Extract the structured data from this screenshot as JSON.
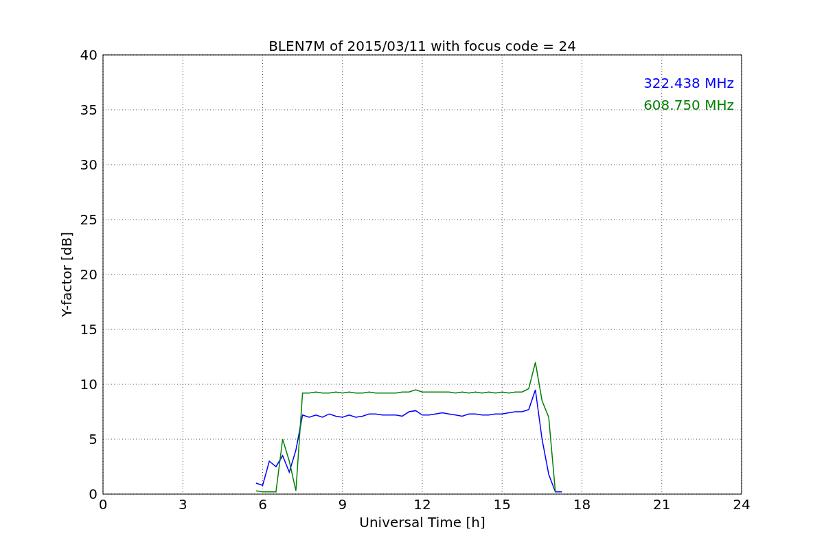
{
  "chart_data": {
    "type": "line",
    "grid": true,
    "title": "BLEN7M of 2015/03/11 with focus code = 24",
    "xlabel": "Universal Time [h]",
    "ylabel": "Y-factor [dB]",
    "xlim": [
      0,
      24
    ],
    "ylim": [
      0,
      40
    ],
    "xticks": [
      0,
      3,
      6,
      9,
      12,
      15,
      18,
      21,
      24
    ],
    "yticks": [
      0,
      5,
      10,
      15,
      20,
      25,
      30,
      35,
      40
    ],
    "x": [
      5.75,
      6.0,
      6.25,
      6.5,
      6.75,
      7.0,
      7.25,
      7.5,
      7.75,
      8.0,
      8.25,
      8.5,
      8.75,
      9.0,
      9.25,
      9.5,
      9.75,
      10.0,
      10.25,
      10.5,
      10.75,
      11.0,
      11.25,
      11.5,
      11.75,
      12.0,
      12.25,
      12.5,
      12.75,
      13.0,
      13.25,
      13.5,
      13.75,
      14.0,
      14.25,
      14.5,
      14.75,
      15.0,
      15.25,
      15.5,
      15.75,
      16.0,
      16.25,
      16.5,
      16.75,
      17.0,
      17.25
    ],
    "series": [
      {
        "name": "322.438 MHz",
        "color": "#0000ff",
        "values": [
          1.0,
          0.8,
          3.0,
          2.5,
          3.5,
          2.0,
          4.0,
          7.2,
          7.0,
          7.2,
          7.0,
          7.3,
          7.1,
          7.0,
          7.2,
          7.0,
          7.1,
          7.3,
          7.3,
          7.2,
          7.2,
          7.2,
          7.1,
          7.5,
          7.6,
          7.2,
          7.2,
          7.3,
          7.4,
          7.3,
          7.2,
          7.1,
          7.3,
          7.3,
          7.2,
          7.2,
          7.3,
          7.3,
          7.4,
          7.5,
          7.5,
          7.7,
          9.5,
          5.0,
          1.8,
          0.2,
          0.2
        ]
      },
      {
        "name": "608.750 MHz",
        "color": "#008000",
        "values": [
          0.3,
          0.2,
          0.2,
          0.2,
          5.0,
          3.0,
          0.3,
          9.2,
          9.2,
          9.3,
          9.2,
          9.2,
          9.3,
          9.2,
          9.3,
          9.2,
          9.2,
          9.3,
          9.2,
          9.2,
          9.2,
          9.2,
          9.3,
          9.3,
          9.5,
          9.3,
          9.3,
          9.3,
          9.3,
          9.3,
          9.2,
          9.3,
          9.2,
          9.3,
          9.2,
          9.3,
          9.2,
          9.3,
          9.2,
          9.3,
          9.3,
          9.6,
          12.0,
          8.5,
          7.0,
          0.2,
          null
        ]
      }
    ]
  }
}
